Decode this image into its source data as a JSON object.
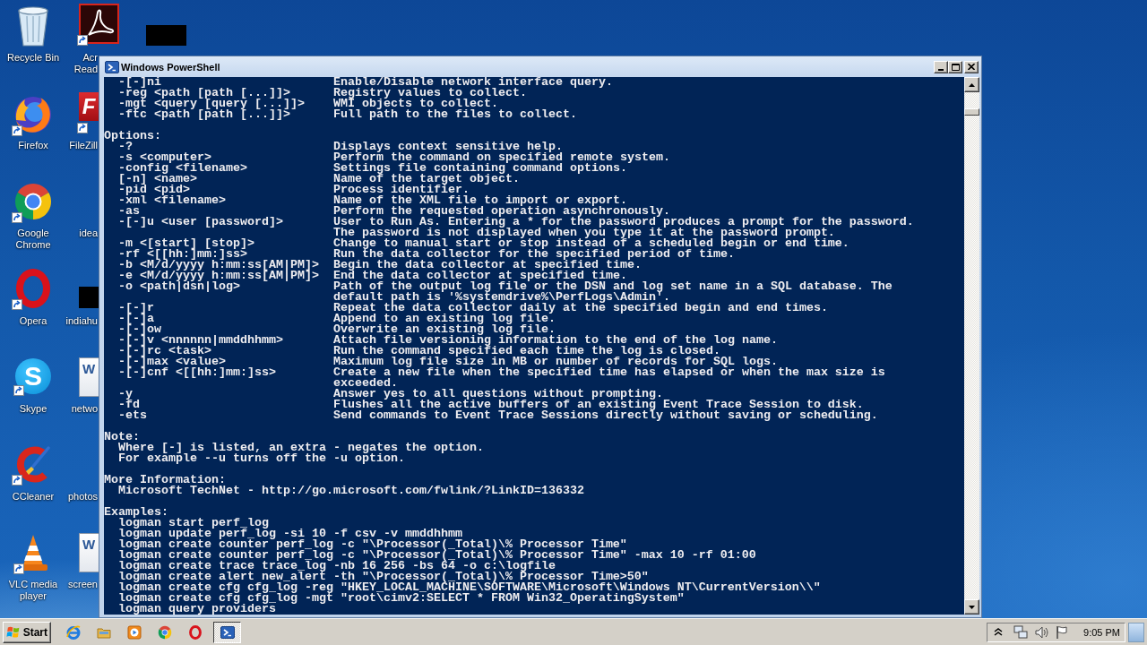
{
  "desktop": {
    "icons": [
      {
        "label": [
          "Recycle Bin"
        ],
        "shortcut": false
      },
      {
        "label": [
          "Firefox"
        ],
        "shortcut": true
      },
      {
        "label": [
          "Google",
          "Chrome"
        ],
        "shortcut": true
      },
      {
        "label": [
          "Opera"
        ],
        "shortcut": true
      },
      {
        "label": [
          "Skype"
        ],
        "shortcut": true,
        "glyph": "S"
      },
      {
        "label": [
          "CCleaner"
        ],
        "shortcut": true
      },
      {
        "label": [
          "VLC media",
          "player"
        ],
        "shortcut": true
      },
      {
        "label": [
          "Acr",
          "Read"
        ],
        "shortcut": true
      },
      {
        "label": [
          "FileZill"
        ],
        "shortcut": true,
        "glyph": "F"
      },
      {
        "label": [
          "idea"
        ]
      },
      {
        "label": [
          "indiahu"
        ],
        "shortcut": false
      },
      {
        "label": [
          "netwo"
        ],
        "shortcut": false,
        "glyph": "W"
      },
      {
        "label": [
          "photos"
        ]
      },
      {
        "label": [
          "screen"
        ],
        "shortcut": false,
        "glyph": "W"
      }
    ]
  },
  "window": {
    "title": "Windows PowerShell",
    "console": {
      "blocks": [
        {
          "kind": "options",
          "rows": [
            {
              "option": "-[-]ni",
              "description": [
                "Enable/Disable network interface query."
              ]
            },
            {
              "option": "-reg <path [path [...]]>",
              "description": [
                "Registry values to collect."
              ]
            },
            {
              "option": "-mgt <query [query [...]]>",
              "description": [
                "WMI objects to collect."
              ]
            },
            {
              "option": "-ftc <path [path [...]]>",
              "description": [
                "Full path to the files to collect."
              ]
            }
          ]
        },
        {
          "kind": "options",
          "heading": "Options:",
          "rows": [
            {
              "option": "-?",
              "description": [
                "Displays context sensitive help."
              ]
            },
            {
              "option": "-s <computer>",
              "description": [
                "Perform the command on specified remote system."
              ]
            },
            {
              "option": "-config <filename>",
              "description": [
                "Settings file containing command options."
              ]
            },
            {
              "option": "[-n] <name>",
              "description": [
                "Name of the target object."
              ]
            },
            {
              "option": "-pid <pid>",
              "description": [
                "Process identifier."
              ]
            },
            {
              "option": "-xml <filename>",
              "description": [
                "Name of the XML file to import or export."
              ]
            },
            {
              "option": "-as",
              "description": [
                "Perform the requested operation asynchronously."
              ]
            },
            {
              "option": "-[-]u <user [password]>",
              "description": [
                "User to Run As. Entering a * for the password produces a prompt for the password.",
                "The password is not displayed when you type it at the password prompt."
              ]
            },
            {
              "option": "-m <[start] [stop]>",
              "description": [
                "Change to manual start or stop instead of a scheduled begin or end time."
              ]
            },
            {
              "option": "-rf <[[hh:]mm:]ss>",
              "description": [
                "Run the data collector for the specified period of time."
              ]
            },
            {
              "option": "-b <M/d/yyyy h:mm:ss[AM|PM]>",
              "description": [
                "Begin the data collector at specified time."
              ]
            },
            {
              "option": "-e <M/d/yyyy h:mm:ss[AM|PM]>",
              "description": [
                "End the data collector at specified time."
              ]
            },
            {
              "option": "-o <path|dsn|log>",
              "description": [
                "Path of the output log file or the DSN and log set name in a SQL database. The",
                "default path is '%systemdrive%\\PerfLogs\\Admin'."
              ]
            },
            {
              "option": "-[-]r",
              "description": [
                "Repeat the data collector daily at the specified begin and end times."
              ]
            },
            {
              "option": "-[-]a",
              "description": [
                "Append to an existing log file."
              ]
            },
            {
              "option": "-[-]ow",
              "description": [
                "Overwrite an existing log file."
              ]
            },
            {
              "option": "-[-]v <nnnnnn|mmddhhmm>",
              "description": [
                "Attach file versioning information to the end of the log name."
              ]
            },
            {
              "option": "-[-]rc <task>",
              "description": [
                "Run the command specified each time the log is closed."
              ]
            },
            {
              "option": "-[-]max <value>",
              "description": [
                "Maximum log file size in MB or number of records for SQL logs."
              ]
            },
            {
              "option": "-[-]cnf <[[hh:]mm:]ss>",
              "description": [
                "Create a new file when the specified time has elapsed or when the max size is",
                "exceeded."
              ]
            },
            {
              "option": "-y",
              "description": [
                "Answer yes to all questions without prompting."
              ]
            },
            {
              "option": "-fd",
              "description": [
                "Flushes all the active buffers of an existing Event Trace Session to disk."
              ]
            },
            {
              "option": "-ets",
              "description": [
                "Send commands to Event Trace Sessions directly without saving or scheduling."
              ]
            }
          ]
        },
        {
          "kind": "text",
          "heading": "Note:",
          "lines": [
            "Where [-] is listed, an extra - negates the option.",
            "For example --u turns off the -u option."
          ]
        },
        {
          "kind": "text",
          "heading": "More Information:",
          "lines": [
            "Microsoft TechNet - http://go.microsoft.com/fwlink/?LinkID=136332"
          ]
        },
        {
          "kind": "text",
          "heading": "Examples:",
          "lines": [
            "logman start perf_log",
            "logman update perf_log -si 10 -f csv -v mmddhhmm",
            "logman create counter perf_log -c \"\\Processor(_Total)\\% Processor Time\"",
            "logman create counter perf_log -c \"\\Processor(_Total)\\% Processor Time\" -max 10 -rf 01:00",
            "logman create trace trace_log -nb 16 256 -bs 64 -o c:\\logfile",
            "logman create alert new_alert -th \"\\Processor(_Total)\\% Processor Time>50\"",
            "logman create cfg cfg_log -reg \"HKEY_LOCAL_MACHINE\\SOFTWARE\\Microsoft\\Windows NT\\CurrentVersion\\\\\"",
            "logman create cfg cfg_log -mgt \"root\\cimv2:SELECT * FROM Win32_OperatingSystem\"",
            "logman query providers"
          ]
        }
      ]
    }
  },
  "taskbar": {
    "start": "Start",
    "tasks": [
      {
        "selected": true
      }
    ],
    "clock": "9:05 PM"
  }
}
